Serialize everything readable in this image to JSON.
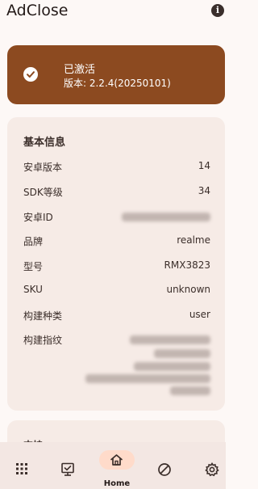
{
  "app": {
    "title": "AdClose"
  },
  "status": {
    "title": "已激活",
    "version_text": "版本: 2.2.4(20250101)",
    "accent_color": "#8c4a20"
  },
  "info_card": {
    "title": "基本信息",
    "rows": [
      {
        "label": "安卓版本",
        "value": "14"
      },
      {
        "label": "SDK等级",
        "value": "34"
      },
      {
        "label": "安卓ID",
        "value": null
      },
      {
        "label": "品牌",
        "value": "realme"
      },
      {
        "label": "型号",
        "value": "RMX3823"
      },
      {
        "label": "SKU",
        "value": "unknown"
      },
      {
        "label": "构建种类",
        "value": "user"
      },
      {
        "label": "构建指纹",
        "value": null
      }
    ]
  },
  "next_card": {
    "title": "支持"
  },
  "nav": {
    "items": [
      {
        "icon": "apps-grid-icon"
      },
      {
        "icon": "monitor-check-icon"
      },
      {
        "icon": "home-icon",
        "label": "Home",
        "active": true
      },
      {
        "icon": "block-icon"
      },
      {
        "icon": "settings-gear-icon"
      }
    ]
  }
}
